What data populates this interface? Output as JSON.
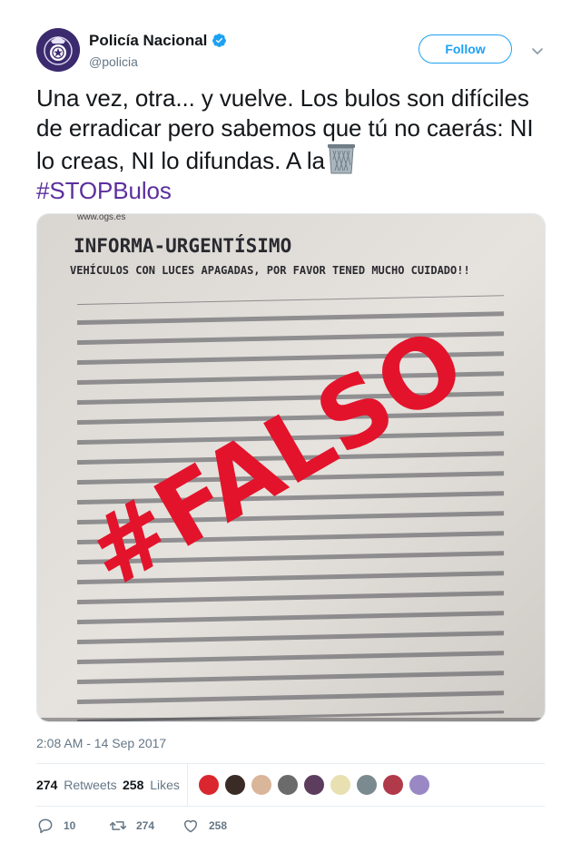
{
  "author": {
    "name": "Policía Nacional",
    "handle": "@policia",
    "verified": true,
    "avatar_icon": "police-badge-icon"
  },
  "header": {
    "follow_label": "Follow",
    "menu_icon": "chevron-down-icon"
  },
  "tweet": {
    "text_main": "Una vez, otra... y vuelve. Los bulos son difíciles de erradicar pero sabemos que tú no caerás: NI lo creas, NI lo difundas. A la",
    "emoji_icon": "wastebasket-icon",
    "hashtag": "#STOPBulos",
    "hashtag_color": "#5b2f9e"
  },
  "photo": {
    "stamp_text": "#FALSO",
    "stamp_color": "#e3132b",
    "doc_header": "INFORMA-URGENTÍSIMO",
    "doc_subheader": "VEHÍCULOS CON LUCES APAGADAS, POR FAVOR TENED MUCHO CUIDADO!!",
    "doc_url": "www.ogs.es"
  },
  "meta": {
    "timestamp": "2:08 AM - 14 Sep 2017"
  },
  "stats": {
    "retweets_count": "274",
    "retweets_label": "Retweets",
    "likes_count": "258",
    "likes_label": "Likes"
  },
  "actions": {
    "reply_count": "10",
    "retweet_count": "274",
    "like_count": "258"
  },
  "colors": {
    "accent": "#1da1f2",
    "muted": "#657786",
    "text": "#14171a"
  }
}
